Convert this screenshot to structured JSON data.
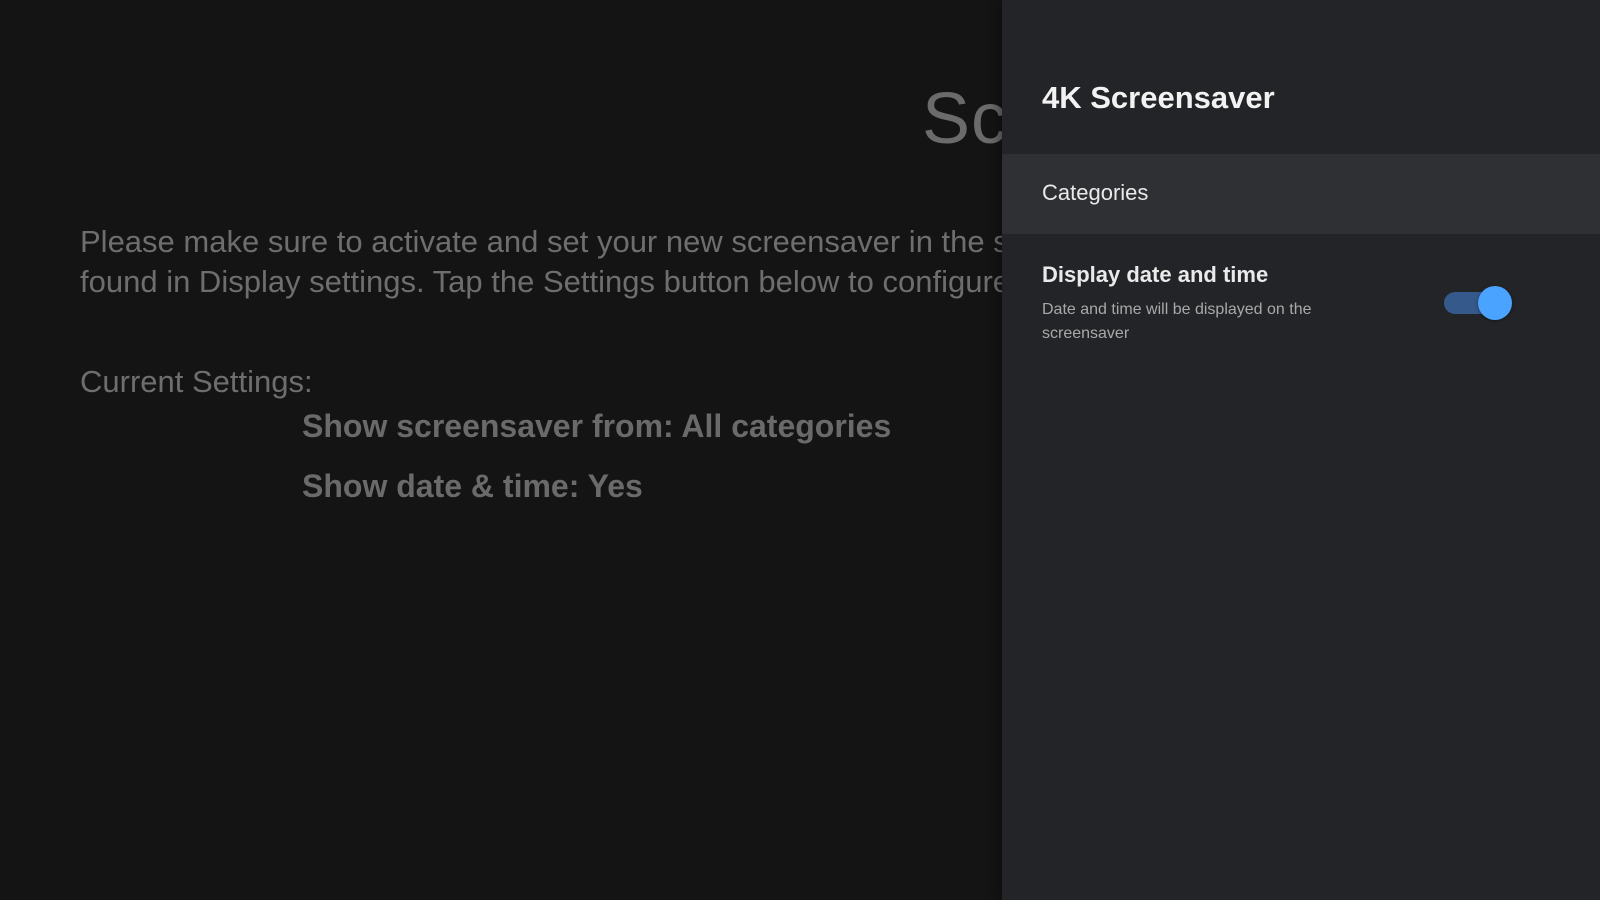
{
  "background": {
    "title": "Sc",
    "description_lines": [
      "Please make sure to activate and set your new screensaver in the syst",
      "found in Display settings. Tap the Settings button below to configure S"
    ],
    "current_settings_label": "Current Settings:",
    "settings": [
      "Show screensaver from: All categories",
      "Show date & time: Yes"
    ]
  },
  "panel": {
    "title": "4K Screensaver",
    "categories_label": "Categories",
    "date_time": {
      "title": "Display date and time",
      "subtitle": "Date and time will be displayed on the screensaver",
      "enabled": true
    }
  },
  "colors": {
    "accent": "#4aa3ff",
    "panel_bg": "#232427",
    "selected_row_bg": "#2f3033"
  }
}
